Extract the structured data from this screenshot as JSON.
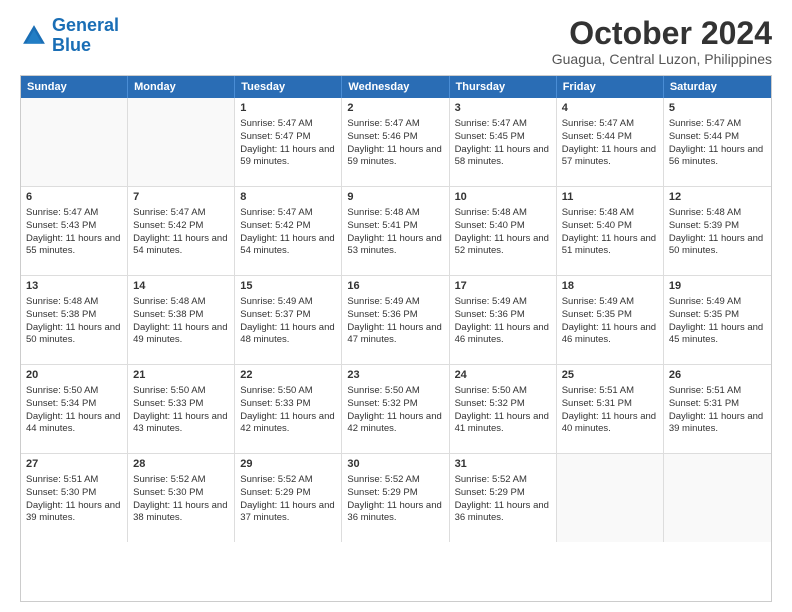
{
  "logo": {
    "line1": "General",
    "line2": "Blue"
  },
  "title": "October 2024",
  "location": "Guagua, Central Luzon, Philippines",
  "header": {
    "days": [
      "Sunday",
      "Monday",
      "Tuesday",
      "Wednesday",
      "Thursday",
      "Friday",
      "Saturday"
    ]
  },
  "weeks": [
    [
      {
        "day": "",
        "sunrise": "",
        "sunset": "",
        "daylight": ""
      },
      {
        "day": "",
        "sunrise": "",
        "sunset": "",
        "daylight": ""
      },
      {
        "day": "1",
        "sunrise": "Sunrise: 5:47 AM",
        "sunset": "Sunset: 5:47 PM",
        "daylight": "Daylight: 11 hours and 59 minutes."
      },
      {
        "day": "2",
        "sunrise": "Sunrise: 5:47 AM",
        "sunset": "Sunset: 5:46 PM",
        "daylight": "Daylight: 11 hours and 59 minutes."
      },
      {
        "day": "3",
        "sunrise": "Sunrise: 5:47 AM",
        "sunset": "Sunset: 5:45 PM",
        "daylight": "Daylight: 11 hours and 58 minutes."
      },
      {
        "day": "4",
        "sunrise": "Sunrise: 5:47 AM",
        "sunset": "Sunset: 5:44 PM",
        "daylight": "Daylight: 11 hours and 57 minutes."
      },
      {
        "day": "5",
        "sunrise": "Sunrise: 5:47 AM",
        "sunset": "Sunset: 5:44 PM",
        "daylight": "Daylight: 11 hours and 56 minutes."
      }
    ],
    [
      {
        "day": "6",
        "sunrise": "Sunrise: 5:47 AM",
        "sunset": "Sunset: 5:43 PM",
        "daylight": "Daylight: 11 hours and 55 minutes."
      },
      {
        "day": "7",
        "sunrise": "Sunrise: 5:47 AM",
        "sunset": "Sunset: 5:42 PM",
        "daylight": "Daylight: 11 hours and 54 minutes."
      },
      {
        "day": "8",
        "sunrise": "Sunrise: 5:47 AM",
        "sunset": "Sunset: 5:42 PM",
        "daylight": "Daylight: 11 hours and 54 minutes."
      },
      {
        "day": "9",
        "sunrise": "Sunrise: 5:48 AM",
        "sunset": "Sunset: 5:41 PM",
        "daylight": "Daylight: 11 hours and 53 minutes."
      },
      {
        "day": "10",
        "sunrise": "Sunrise: 5:48 AM",
        "sunset": "Sunset: 5:40 PM",
        "daylight": "Daylight: 11 hours and 52 minutes."
      },
      {
        "day": "11",
        "sunrise": "Sunrise: 5:48 AM",
        "sunset": "Sunset: 5:40 PM",
        "daylight": "Daylight: 11 hours and 51 minutes."
      },
      {
        "day": "12",
        "sunrise": "Sunrise: 5:48 AM",
        "sunset": "Sunset: 5:39 PM",
        "daylight": "Daylight: 11 hours and 50 minutes."
      }
    ],
    [
      {
        "day": "13",
        "sunrise": "Sunrise: 5:48 AM",
        "sunset": "Sunset: 5:38 PM",
        "daylight": "Daylight: 11 hours and 50 minutes."
      },
      {
        "day": "14",
        "sunrise": "Sunrise: 5:48 AM",
        "sunset": "Sunset: 5:38 PM",
        "daylight": "Daylight: 11 hours and 49 minutes."
      },
      {
        "day": "15",
        "sunrise": "Sunrise: 5:49 AM",
        "sunset": "Sunset: 5:37 PM",
        "daylight": "Daylight: 11 hours and 48 minutes."
      },
      {
        "day": "16",
        "sunrise": "Sunrise: 5:49 AM",
        "sunset": "Sunset: 5:36 PM",
        "daylight": "Daylight: 11 hours and 47 minutes."
      },
      {
        "day": "17",
        "sunrise": "Sunrise: 5:49 AM",
        "sunset": "Sunset: 5:36 PM",
        "daylight": "Daylight: 11 hours and 46 minutes."
      },
      {
        "day": "18",
        "sunrise": "Sunrise: 5:49 AM",
        "sunset": "Sunset: 5:35 PM",
        "daylight": "Daylight: 11 hours and 46 minutes."
      },
      {
        "day": "19",
        "sunrise": "Sunrise: 5:49 AM",
        "sunset": "Sunset: 5:35 PM",
        "daylight": "Daylight: 11 hours and 45 minutes."
      }
    ],
    [
      {
        "day": "20",
        "sunrise": "Sunrise: 5:50 AM",
        "sunset": "Sunset: 5:34 PM",
        "daylight": "Daylight: 11 hours and 44 minutes."
      },
      {
        "day": "21",
        "sunrise": "Sunrise: 5:50 AM",
        "sunset": "Sunset: 5:33 PM",
        "daylight": "Daylight: 11 hours and 43 minutes."
      },
      {
        "day": "22",
        "sunrise": "Sunrise: 5:50 AM",
        "sunset": "Sunset: 5:33 PM",
        "daylight": "Daylight: 11 hours and 42 minutes."
      },
      {
        "day": "23",
        "sunrise": "Sunrise: 5:50 AM",
        "sunset": "Sunset: 5:32 PM",
        "daylight": "Daylight: 11 hours and 42 minutes."
      },
      {
        "day": "24",
        "sunrise": "Sunrise: 5:50 AM",
        "sunset": "Sunset: 5:32 PM",
        "daylight": "Daylight: 11 hours and 41 minutes."
      },
      {
        "day": "25",
        "sunrise": "Sunrise: 5:51 AM",
        "sunset": "Sunset: 5:31 PM",
        "daylight": "Daylight: 11 hours and 40 minutes."
      },
      {
        "day": "26",
        "sunrise": "Sunrise: 5:51 AM",
        "sunset": "Sunset: 5:31 PM",
        "daylight": "Daylight: 11 hours and 39 minutes."
      }
    ],
    [
      {
        "day": "27",
        "sunrise": "Sunrise: 5:51 AM",
        "sunset": "Sunset: 5:30 PM",
        "daylight": "Daylight: 11 hours and 39 minutes."
      },
      {
        "day": "28",
        "sunrise": "Sunrise: 5:52 AM",
        "sunset": "Sunset: 5:30 PM",
        "daylight": "Daylight: 11 hours and 38 minutes."
      },
      {
        "day": "29",
        "sunrise": "Sunrise: 5:52 AM",
        "sunset": "Sunset: 5:29 PM",
        "daylight": "Daylight: 11 hours and 37 minutes."
      },
      {
        "day": "30",
        "sunrise": "Sunrise: 5:52 AM",
        "sunset": "Sunset: 5:29 PM",
        "daylight": "Daylight: 11 hours and 36 minutes."
      },
      {
        "day": "31",
        "sunrise": "Sunrise: 5:52 AM",
        "sunset": "Sunset: 5:29 PM",
        "daylight": "Daylight: 11 hours and 36 minutes."
      },
      {
        "day": "",
        "sunrise": "",
        "sunset": "",
        "daylight": ""
      },
      {
        "day": "",
        "sunrise": "",
        "sunset": "",
        "daylight": ""
      }
    ]
  ]
}
